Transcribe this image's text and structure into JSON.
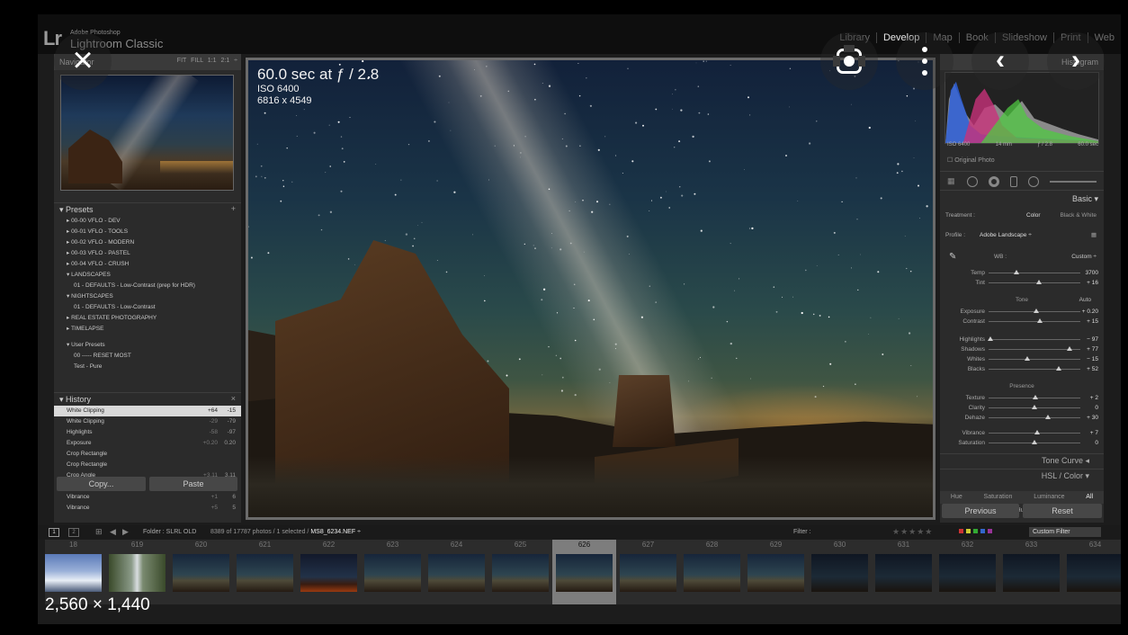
{
  "app": {
    "logo": "Lr",
    "brand_small": "Adobe Photoshop",
    "brand_big": "Lightroom Classic",
    "modules": [
      "Library",
      "Develop",
      "Map",
      "Book",
      "Slideshow",
      "Print",
      "Web"
    ],
    "active_module": "Develop"
  },
  "navigator": {
    "title": "Navigator",
    "options": "FIT  FILL  1:1  2:1 ÷"
  },
  "presets": {
    "title": "Presets",
    "add": "+",
    "items": [
      "▸ 00-00 VFLO - DEV",
      "▸ 00-01 VFLO - TOOLS",
      "▸ 00-02 VFLO - MODERN",
      "▸ 00-03 VFLO - PASTEL",
      "▸ 00-04 VFLO - CRUSH",
      "▾ LANDSCAPES",
      "01 - DEFAULTS - Low-Contrast  (prep for HDR)",
      "▾ NIGHTSCAPES",
      "01 - DEFAULTS - Low-Contrast",
      "▸ REAL ESTATE PHOTOGRAPHY",
      "▸ TIMELAPSE",
      "▾ User Presets",
      "00 ----- RESET MOST",
      "Test - Pure"
    ]
  },
  "history": {
    "title": "History",
    "close": "×",
    "rows": [
      {
        "label": "White Clipping",
        "v1": "+64",
        "v2": "-15"
      },
      {
        "label": "White Clipping",
        "v1": "-29",
        "v2": "-79"
      },
      {
        "label": "Highlights",
        "v1": "-58",
        "v2": "-97"
      },
      {
        "label": "Exposure",
        "v1": "+0.20",
        "v2": "0.20"
      },
      {
        "label": "Crop Rectangle",
        "v1": "",
        "v2": ""
      },
      {
        "label": "Crop Rectangle",
        "v1": "",
        "v2": ""
      },
      {
        "label": "Crop Angle",
        "v1": "+3.11",
        "v2": "3.11"
      },
      {
        "label": "Vibrance",
        "v1": "+1",
        "v2": "7"
      },
      {
        "label": "Vibrance",
        "v1": "+1",
        "v2": "6"
      },
      {
        "label": "Vibrance",
        "v1": "+5",
        "v2": "5"
      }
    ]
  },
  "left_buttons": {
    "copy": "Copy...",
    "paste": "Paste"
  },
  "photo_info": {
    "shutter": "60.0 sec at ƒ / 2.8",
    "iso": "ISO 6400",
    "size": "6816 x 4549"
  },
  "histogram": {
    "title": "Histogram",
    "iso": "ISO 6400",
    "focal": "14 mm",
    "aperture": "ƒ / 2.8",
    "shutter": "60.0 sec",
    "original": "Original Photo"
  },
  "basic": {
    "title": "Basic",
    "treatment_label": "Treatment :",
    "treatment_color": "Color",
    "treatment_bw": "Black & White",
    "profile_label": "Profile :",
    "profile_value": "Adobe Landscape ÷",
    "wb_label": "WB :",
    "wb_value": "Custom ÷",
    "tone_title": "Tone",
    "tone_auto": "Auto",
    "presence_title": "Presence",
    "sliders_wb": [
      {
        "label": "Temp",
        "value": "3700",
        "pos": 0.3
      },
      {
        "label": "Tint",
        "value": "+ 16",
        "pos": 0.55
      }
    ],
    "sliders_tone1": [
      {
        "label": "Exposure",
        "value": "+ 0.20",
        "pos": 0.52
      },
      {
        "label": "Contrast",
        "value": "+ 15",
        "pos": 0.56
      }
    ],
    "sliders_tone2": [
      {
        "label": "Highlights",
        "value": "− 97",
        "pos": 0.02
      },
      {
        "label": "Shadows",
        "value": "+ 77",
        "pos": 0.88
      },
      {
        "label": "Whites",
        "value": "− 15",
        "pos": 0.42
      },
      {
        "label": "Blacks",
        "value": "+ 52",
        "pos": 0.76
      }
    ],
    "sliders_presence1": [
      {
        "label": "Texture",
        "value": "+ 2",
        "pos": 0.51
      },
      {
        "label": "Clarity",
        "value": "0",
        "pos": 0.5
      },
      {
        "label": "Dehaze",
        "value": "+ 30",
        "pos": 0.65
      }
    ],
    "sliders_presence2": [
      {
        "label": "Vibrance",
        "value": "+ 7",
        "pos": 0.53
      },
      {
        "label": "Saturation",
        "value": "0",
        "pos": 0.5
      }
    ]
  },
  "right_sections": {
    "tone_curve": "Tone Curve",
    "hsl": "HSL / Color",
    "hsl_tabs": [
      "Hue",
      "Saturation",
      "Luminance",
      "All"
    ],
    "hue": "Hue"
  },
  "right_buttons": {
    "previous": "Previous",
    "reset": "Reset"
  },
  "filmstrip_bar": {
    "view1": "1",
    "view2": "2",
    "folder": "Folder : SLRL OLD",
    "count_prefix": "8389 of 17787 photos / 1 selected /",
    "filename": "MS8_6234.NEF ÷",
    "filter_label": "Filter :",
    "custom_filter": "Custom Filter"
  },
  "filmstrip": [
    {
      "num": "18",
      "style": "snow"
    },
    {
      "num": "619",
      "style": "waterfall"
    },
    {
      "num": "620",
      "style": "night"
    },
    {
      "num": "621",
      "style": "night"
    },
    {
      "num": "622",
      "style": "fire"
    },
    {
      "num": "623",
      "style": "night"
    },
    {
      "num": "624",
      "style": "night"
    },
    {
      "num": "625",
      "style": "night"
    },
    {
      "num": "626",
      "style": "night",
      "selected": true
    },
    {
      "num": "627",
      "style": "night"
    },
    {
      "num": "628",
      "style": "night"
    },
    {
      "num": "629",
      "style": "night"
    },
    {
      "num": "630",
      "style": "dark"
    },
    {
      "num": "631",
      "style": "dark"
    },
    {
      "num": "632",
      "style": "dark"
    },
    {
      "num": "633",
      "style": "dark"
    },
    {
      "num": "634",
      "style": "dark"
    }
  ],
  "viewer": {
    "resolution": "2,560 × 1,440",
    "close_icon": "×",
    "prev_icon": "‹",
    "next_icon": "›"
  }
}
